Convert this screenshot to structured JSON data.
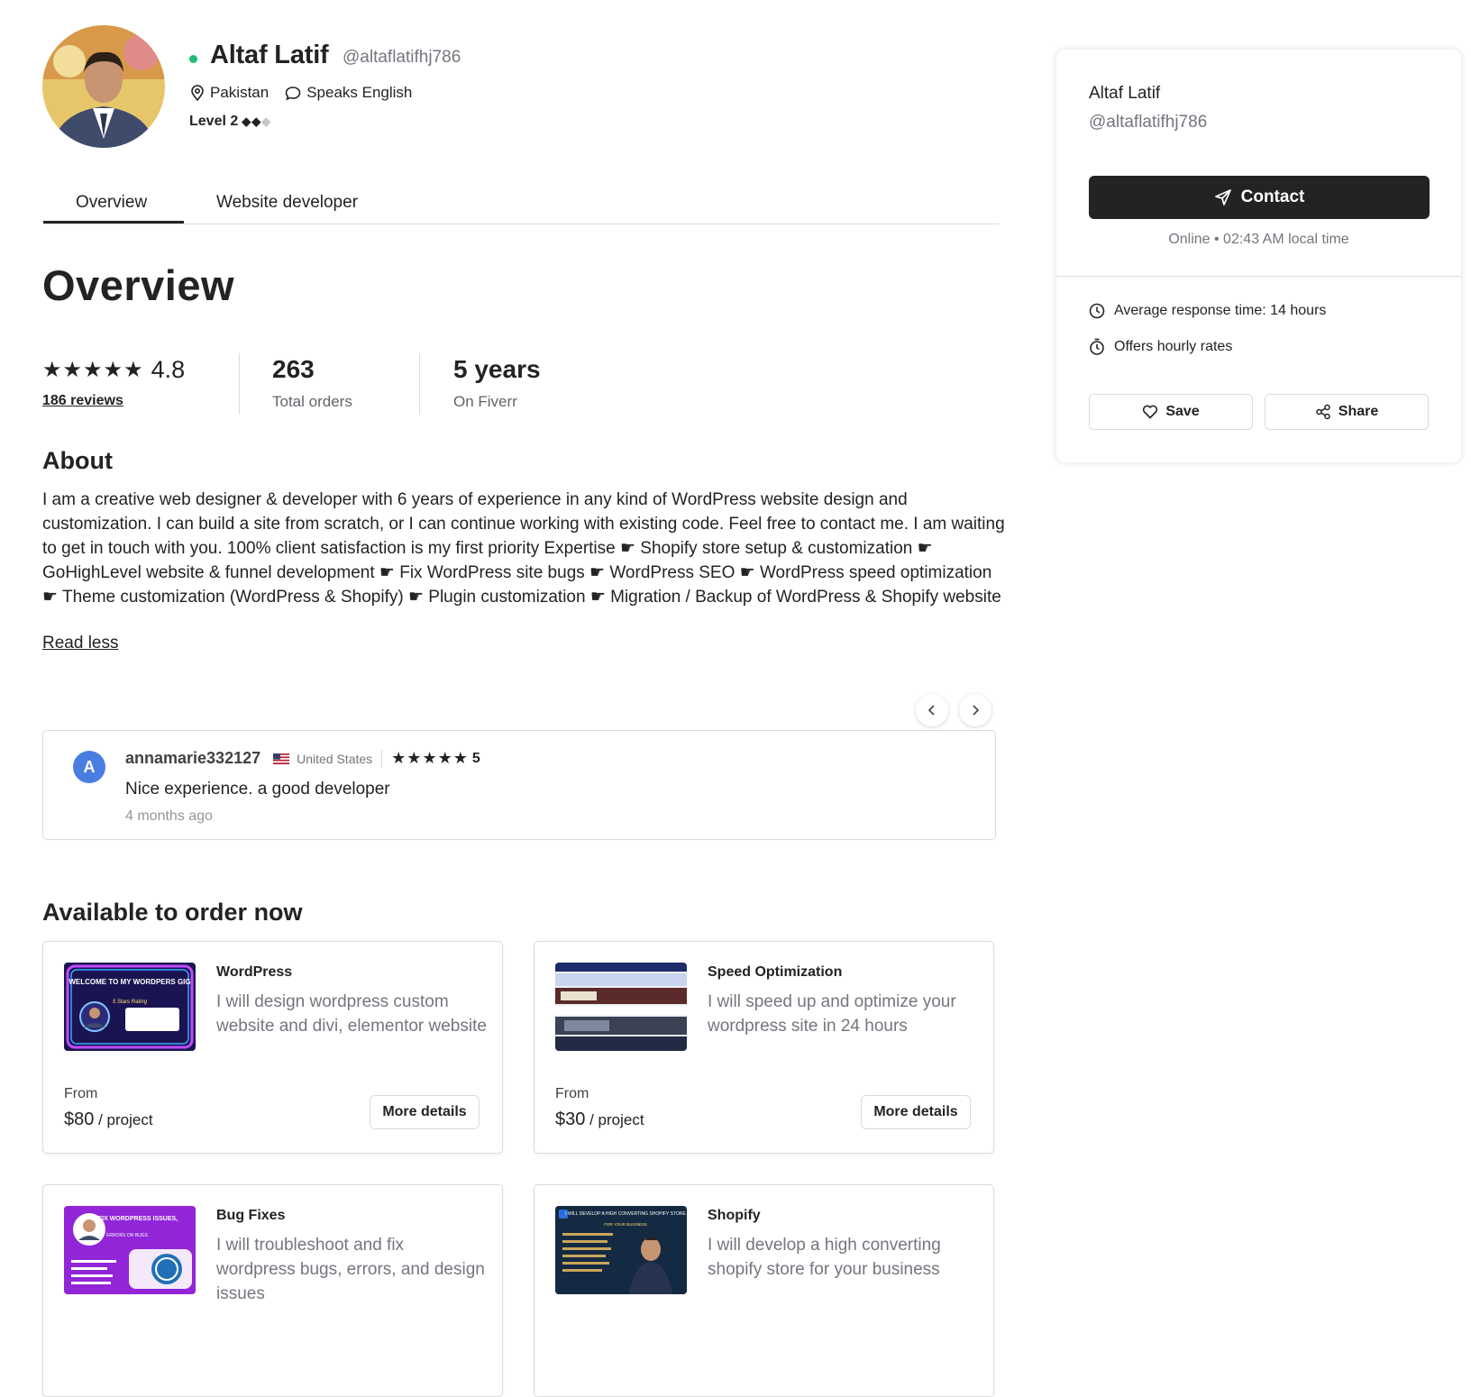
{
  "profile": {
    "name": "Altaf Latif",
    "handle": "@altaflatifhj786",
    "country": "Pakistan",
    "language": "Speaks English",
    "level_label": "Level 2",
    "level_diamonds_filled": "◆◆",
    "level_diamonds_empty": "◆",
    "online_color": "#1dbf73"
  },
  "tabs": [
    {
      "label": "Overview",
      "active": true
    },
    {
      "label": "Website developer",
      "active": false
    }
  ],
  "overview": {
    "title": "Overview",
    "rating_stars": "★★★★★",
    "rating": "4.8",
    "reviews_link": "186 reviews",
    "orders_value": "263",
    "orders_label": "Total orders",
    "years_value": "5 years",
    "years_label": "On Fiverr"
  },
  "about": {
    "title": "About",
    "text": "I am a creative web designer & developer with 6 years of experience in any kind of WordPress website design and customization. I can build a site from scratch, or I can continue working with existing code. Feel free to contact me. I am waiting to get in touch with you. 100% client satisfaction is my first priority Expertise ☛ Shopify store setup & customization ☛ GoHighLevel website & funnel development ☛ Fix WordPress site bugs ☛ WordPress SEO ☛ WordPress speed optimization ☛ Theme customization (WordPress & Shopify) ☛ Plugin customization ☛ Migration / Backup of WordPress & Shopify website",
    "read_less": "Read less"
  },
  "review": {
    "avatar_letter": "A",
    "reviewer": "annamarie332127",
    "country": "United States",
    "stars": "★★★★★",
    "score": "5",
    "text": "Nice experience. a good developer",
    "time": "4 months ago",
    "prev_icon": "chevron-left-icon",
    "next_icon": "chevron-right-icon"
  },
  "gigs": {
    "title": "Available to order now",
    "items": [
      {
        "category": "WordPress",
        "description": "I will design wordpress custom website and divi, elementor website",
        "from_label": "From",
        "price": "$80",
        "unit": " / project",
        "button": "More details",
        "thumb_title": "WELCOME TO MY WORDPERS GIG",
        "thumb_sub": "5 Stars Rating"
      },
      {
        "category": "Speed Optimization",
        "description": "I will speed up and optimize your wordpress site in 24 hours",
        "from_label": "From",
        "price": "$30",
        "unit": " / project",
        "button": "More details"
      },
      {
        "category": "Bug Fixes",
        "description": "I will troubleshoot and fix wordpress bugs, errors, and design issues",
        "thumb_title": "FIX WORDPRESS ISSUES,",
        "thumb_sub": "ERRORS OR BUGS"
      },
      {
        "category": "Shopify",
        "description": "I will develop a high converting shopify store for your business",
        "thumb_title": "I WILL DEVELOP A HIGH CONVERTING SHOPIFY STORE",
        "thumb_sub": "FOR YOUR BUSINESS"
      }
    ]
  },
  "sidebar": {
    "name": "Altaf Latif",
    "handle": "@altaflatifhj786",
    "contact": "Contact",
    "status": "Online • 02:43 AM local time",
    "response": "Average response time: 14 hours",
    "hourly": "Offers hourly rates",
    "save": "Save",
    "share": "Share"
  },
  "colors": {
    "text": "#222325",
    "muted": "#74767e",
    "border": "#dadbdd",
    "contact_bg": "#222325",
    "review_avatar": "#4a7de2"
  }
}
